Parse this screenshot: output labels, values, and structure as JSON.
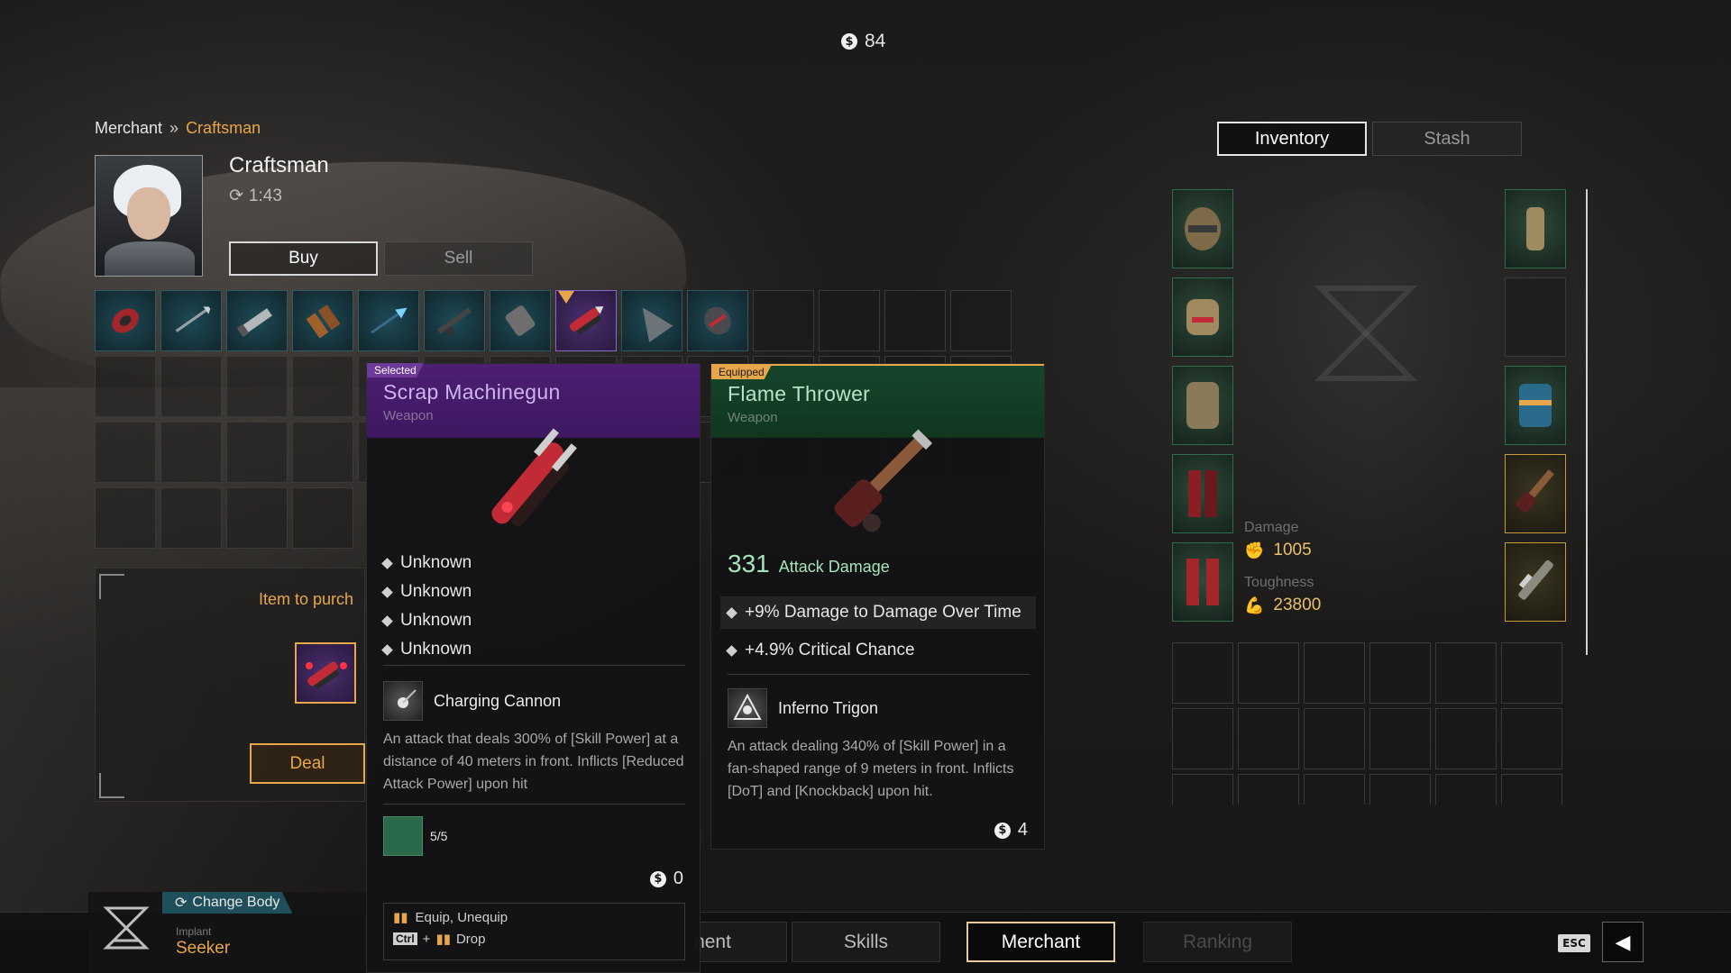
{
  "currency": {
    "amount": "84"
  },
  "breadcrumb": {
    "root": "Merchant",
    "current": "Craftsman"
  },
  "merchant": {
    "name": "Craftsman",
    "timer": "1:43",
    "buy_label": "Buy",
    "sell_label": "Sell"
  },
  "purchase": {
    "label": "Item to purch",
    "deal_label": "Deal"
  },
  "selected_item": {
    "tag": "Selected",
    "name": "Scrap Machinegun",
    "type": "Weapon",
    "stats": [
      "Unknown",
      "Unknown",
      "Unknown",
      "Unknown"
    ],
    "skill_name": "Charging Cannon",
    "skill_desc": "An attack that deals 300% of [Skill Power] at a distance of 40 meters in front. Inflicts [Reduced Attack Power] upon hit",
    "material_count": "5/5",
    "price": "0",
    "hint_equip": "Equip, Unequip",
    "hint_ctrl": "Ctrl",
    "hint_plus": "+",
    "hint_drop": "Drop"
  },
  "equipped_item": {
    "tag": "Equipped",
    "name": "Flame Thrower",
    "type": "Weapon",
    "attack_value": "331",
    "attack_label": "Attack Damage",
    "stats": [
      "+9% Damage to Damage Over Time",
      "+4.9% Critical Chance"
    ],
    "skill_name": "Inferno Trigon",
    "skill_desc": "An attack dealing 340% of [Skill Power] in a fan-shaped range of 9 meters in front. Inflicts [DoT] and [Knockback] upon hit.",
    "price": "4"
  },
  "inventory": {
    "tab_inventory": "Inventory",
    "tab_stash": "Stash",
    "damage_label": "Damage",
    "damage_value": "1005",
    "toughness_label": "Toughness",
    "toughness_value": "23800"
  },
  "body": {
    "change_label": "Change Body",
    "implant_label": "Implant",
    "implant_value": "Seeker"
  },
  "nav": {
    "equipment_partial": "nent",
    "skills": "Skills",
    "merchant": "Merchant",
    "ranking": "Ranking",
    "esc": "ESC"
  },
  "colors": {
    "accent": "#e8a64a",
    "selected": "#4d1f73",
    "equipped": "#16452c"
  }
}
